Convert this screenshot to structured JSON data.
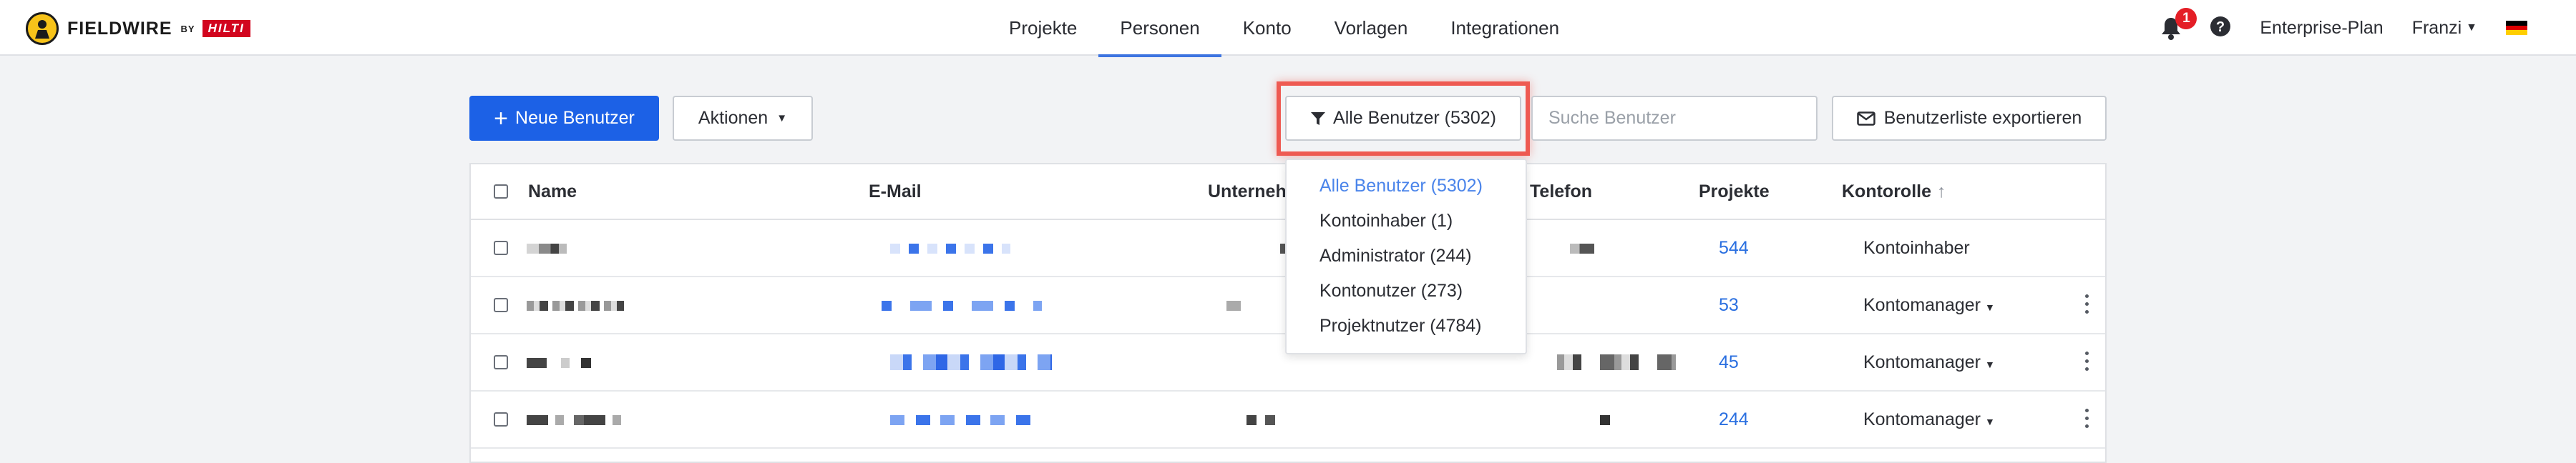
{
  "header": {
    "brand": "FIELDWIRE",
    "brand_by": "BY",
    "partner": "HILTI",
    "nav": [
      {
        "label": "Projekte",
        "active": false
      },
      {
        "label": "Personen",
        "active": true
      },
      {
        "label": "Konto",
        "active": false
      },
      {
        "label": "Vorlagen",
        "active": false
      },
      {
        "label": "Integrationen",
        "active": false
      }
    ],
    "notification_count": "1",
    "plan": "Enterprise-Plan",
    "user": "Franzi",
    "language_flag_colors": [
      "#000000",
      "#dd0000",
      "#ffce00"
    ]
  },
  "toolbar": {
    "new_user_label": "Neue Benutzer",
    "actions_label": "Aktionen",
    "filter_label": "Alle Benutzer (5302)",
    "search_placeholder": "Suche Benutzer",
    "export_label": "Benutzerliste exportieren"
  },
  "table": {
    "columns": {
      "name": "Name",
      "email": "E-Mail",
      "company": "Unternehmen",
      "phone": "Telefon",
      "projects": "Projekte",
      "role": "Kontorolle"
    },
    "rows": [
      {
        "projects": "544",
        "role": "Kontoinhaber",
        "role_dropdown": false
      },
      {
        "projects": "53",
        "role": "Kontomanager",
        "role_dropdown": true
      },
      {
        "projects": "45",
        "role": "Kontomanager",
        "role_dropdown": true
      },
      {
        "projects": "244",
        "role": "Kontomanager",
        "role_dropdown": true
      }
    ]
  },
  "filter_dropdown": {
    "items": [
      {
        "label": "Alle Benutzer (5302)",
        "selected": true
      },
      {
        "label": "Kontoinhaber (1)",
        "selected": false
      },
      {
        "label": "Administrator (244)",
        "selected": false
      },
      {
        "label": "Kontonutzer (273)",
        "selected": false
      },
      {
        "label": "Projektnutzer (4784)",
        "selected": false
      }
    ]
  },
  "colors": {
    "accent": "#1c61e6",
    "link": "#2a6fe0",
    "highlight": "#ee5a52",
    "badge": "#e41e26"
  }
}
